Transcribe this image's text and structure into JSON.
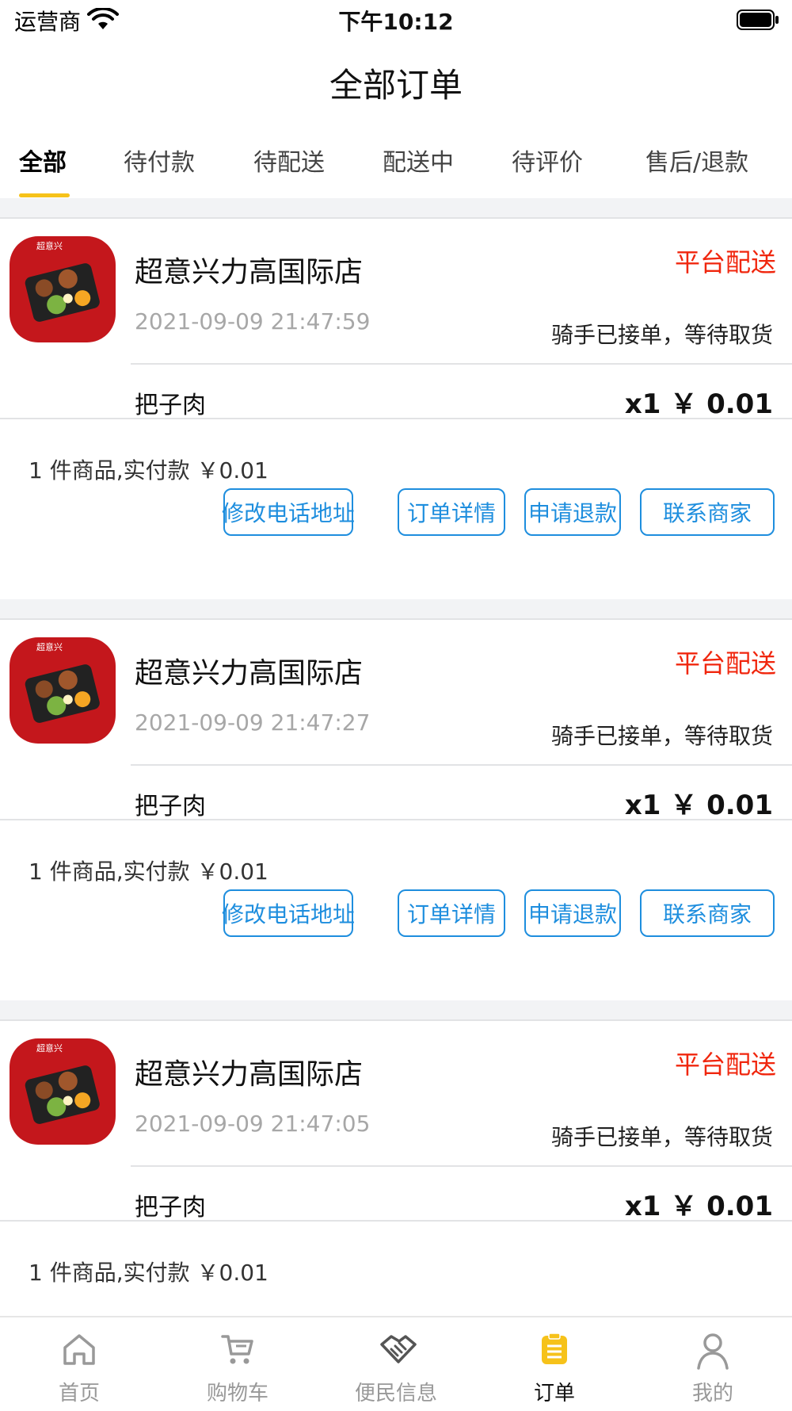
{
  "status_bar": {
    "carrier": "运营商",
    "time": "下午10:12"
  },
  "page_title": "全部订单",
  "tabs": [
    {
      "label": "全部",
      "active": true
    },
    {
      "label": "待付款",
      "active": false
    },
    {
      "label": "待配送",
      "active": false
    },
    {
      "label": "配送中",
      "active": false
    },
    {
      "label": "待评价",
      "active": false
    },
    {
      "label": "售后/退款",
      "active": false
    }
  ],
  "colors": {
    "accent": "#f6c21a",
    "delivery_type": "#f0260d",
    "button": "#1e8ede",
    "thumb_red": "#c4171c"
  },
  "orders": [
    {
      "shop_name": "超意兴力高国际店",
      "delivery_type": "平台配送",
      "datetime": "2021-09-09 21:47:59",
      "status": "骑手已接单，等待取货",
      "item_name": "把子肉",
      "item_qty_price": "x1 ￥ 0.01",
      "summary": "1 件商品,实付款 ￥0.01",
      "thumb_brand": "超意兴",
      "buttons": [
        "修改电话地址",
        "订单详情",
        "申请退款",
        "联系商家"
      ]
    },
    {
      "shop_name": "超意兴力高国际店",
      "delivery_type": "平台配送",
      "datetime": "2021-09-09 21:47:27",
      "status": "骑手已接单，等待取货",
      "item_name": "把子肉",
      "item_qty_price": "x1 ￥ 0.01",
      "summary": "1 件商品,实付款 ￥0.01",
      "thumb_brand": "超意兴",
      "buttons": [
        "修改电话地址",
        "订单详情",
        "申请退款",
        "联系商家"
      ]
    },
    {
      "shop_name": "超意兴力高国际店",
      "delivery_type": "平台配送",
      "datetime": "2021-09-09 21:47:05",
      "status": "骑手已接单，等待取货",
      "item_name": "把子肉",
      "item_qty_price": "x1 ￥ 0.01",
      "summary": "1 件商品,实付款 ￥0.01",
      "thumb_brand": "超意兴"
    }
  ],
  "bottom_nav": [
    {
      "label": "首页",
      "icon": "home-icon",
      "active": false
    },
    {
      "label": "购物车",
      "icon": "cart-icon",
      "active": false
    },
    {
      "label": "便民信息",
      "icon": "handshake-icon",
      "active": false
    },
    {
      "label": "订单",
      "icon": "clipboard-icon",
      "active": true
    },
    {
      "label": "我的",
      "icon": "user-icon",
      "active": false
    }
  ]
}
